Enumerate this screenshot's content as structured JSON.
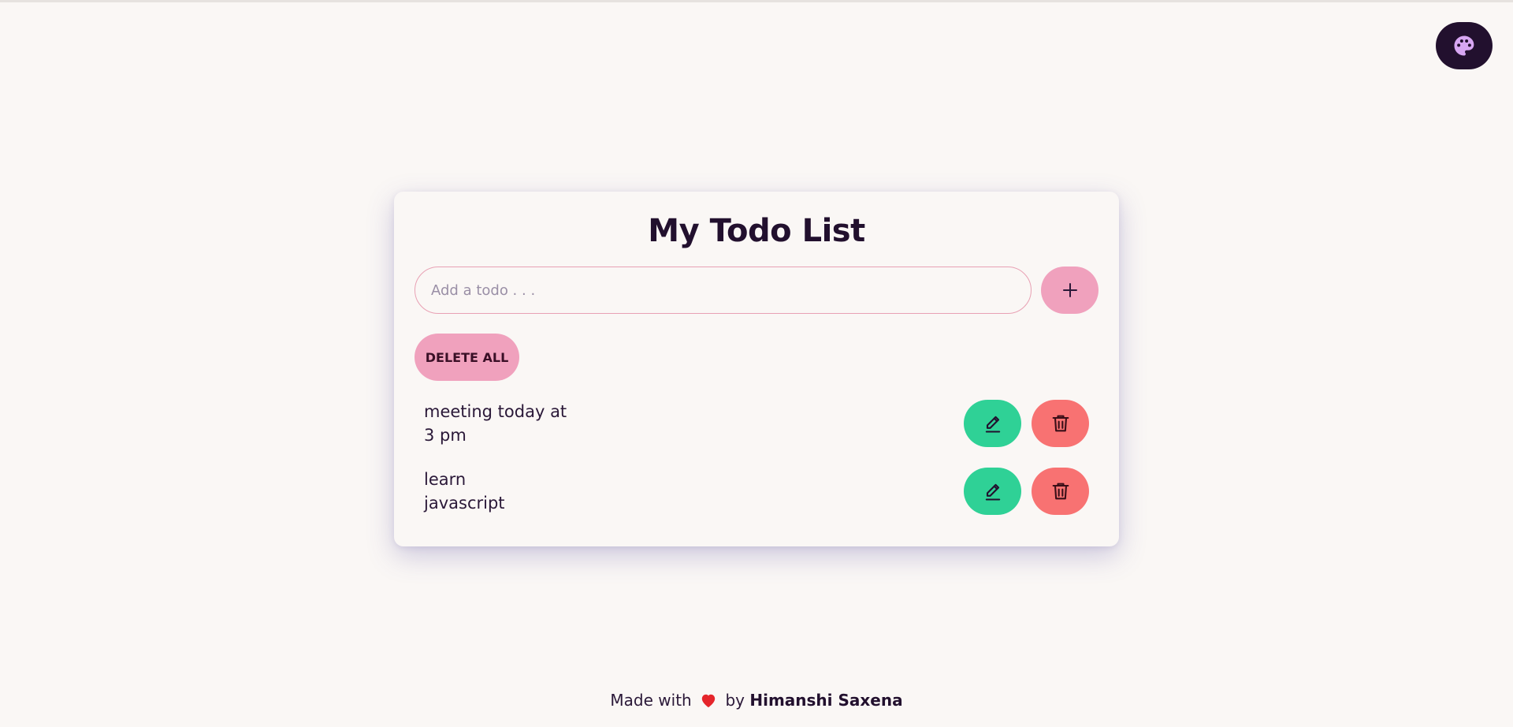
{
  "header": {
    "theme_toggle_icon": "palette-icon"
  },
  "card": {
    "title": "My Todo List",
    "input_placeholder": "Add a todo . . .",
    "input_value": "",
    "add_icon": "plus-icon",
    "delete_all_label": "DELETE ALL"
  },
  "todos": [
    {
      "line1": "meeting today at",
      "line2": "3 pm"
    },
    {
      "line1": "learn",
      "line2": "javascript"
    }
  ],
  "footer": {
    "made_with": "Made with",
    "by": "by",
    "author": "Himanshi Saxena",
    "heart_icon": "heart-icon"
  },
  "colors": {
    "background": "#faf7f5",
    "primary_pink": "#f0a1bd",
    "edit_green": "#2fd196",
    "delete_red": "#f87272",
    "dark": "#22102e"
  }
}
